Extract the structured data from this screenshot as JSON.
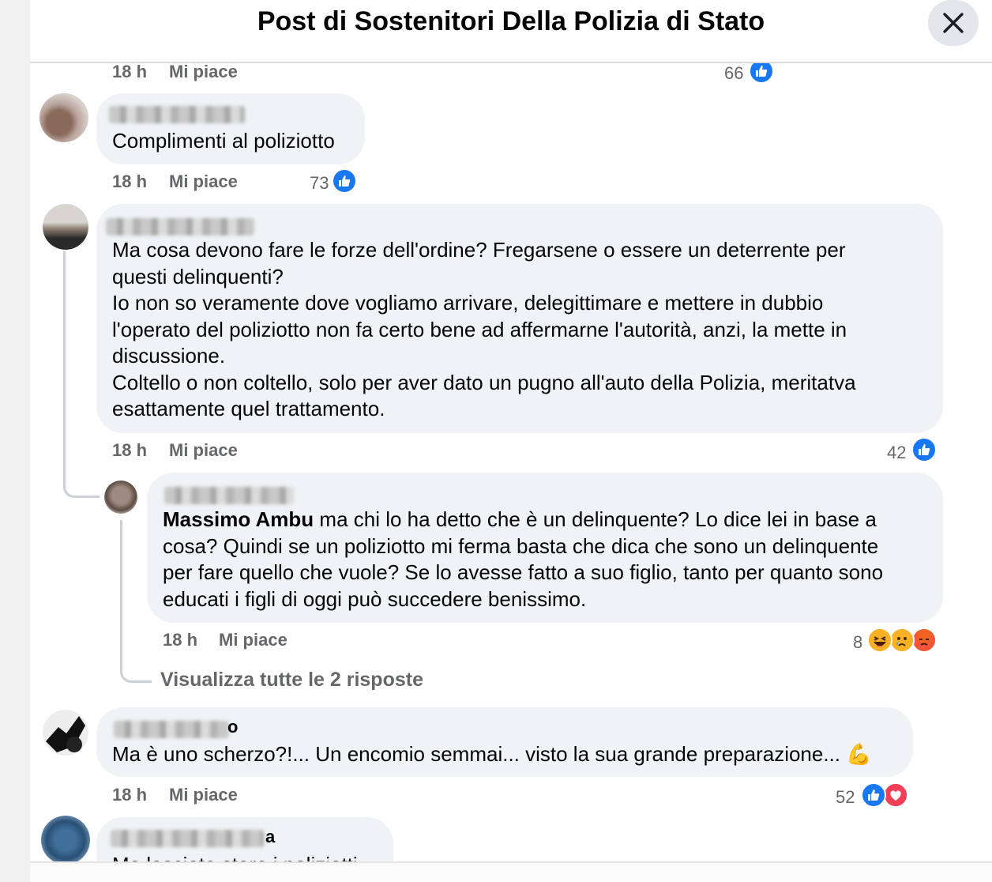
{
  "header": {
    "title": "Post di Sostenitori Della Polizia di Stato",
    "close_icon": "close-icon"
  },
  "actions": {
    "time": "18 h",
    "like": "Mi piace"
  },
  "comments": [
    {
      "text": "",
      "time": "18 h",
      "like": "Mi piace",
      "count": "66",
      "reactions": [
        "like"
      ]
    },
    {
      "text": "Complimenti al poliziotto",
      "time": "18 h",
      "like": "Mi piace",
      "count": "73",
      "reactions": [
        "like"
      ]
    },
    {
      "text": "Ma cosa devono fare le forze dell'ordine? Fregarsene o essere un deterrente per\nquesti delinquenti?\nIo non so veramente dove vogliamo arrivare, delegittimare e mettere in dubbio\nl'operato del poliziotto non fa certo bene ad affermarne l'autorità, anzi, la mette in\ndiscussione.\nColtello o non coltello, solo per aver dato un pugno all'auto della Polizia, meritatva\nesattamente quel trattamento.",
      "time": "18 h",
      "like": "Mi piace",
      "count": "42",
      "reactions": [
        "like"
      ]
    },
    {
      "mention": "Massimo Ambu",
      "text": " ma chi lo ha detto che è un delinquente? Lo dice lei in base a\ncosa? Quindi se un poliziotto mi ferma basta che dica che sono un delinquente\nper fare quello che vuole? Se lo avesse fatto a suo figlio, tanto per quanto sono\neducati i figli di oggi può succedere benissimo.",
      "time": "18 h",
      "like": "Mi piace",
      "count": "8",
      "reactions": [
        "haha",
        "sad",
        "angry"
      ]
    },
    {
      "text": "Ma è uno scherzo?!... Un encomio semmai... visto la sua grande preparazione... 💪",
      "time": "18 h",
      "like": "Mi piace",
      "count": "52",
      "reactions": [
        "like",
        "love"
      ]
    },
    {
      "text": "Ma lasciate stare i poliziotti"
    }
  ],
  "view_replies": "Visualizza tutte le 2 risposte",
  "name_fragments": {
    "c5_suffix": "o",
    "c6_suffix": "a"
  },
  "colors": {
    "like_blue": "#1877f2",
    "love_red": "#f33e58",
    "bubble_bg": "#f0f2f5",
    "meta_gray": "#65676b"
  }
}
